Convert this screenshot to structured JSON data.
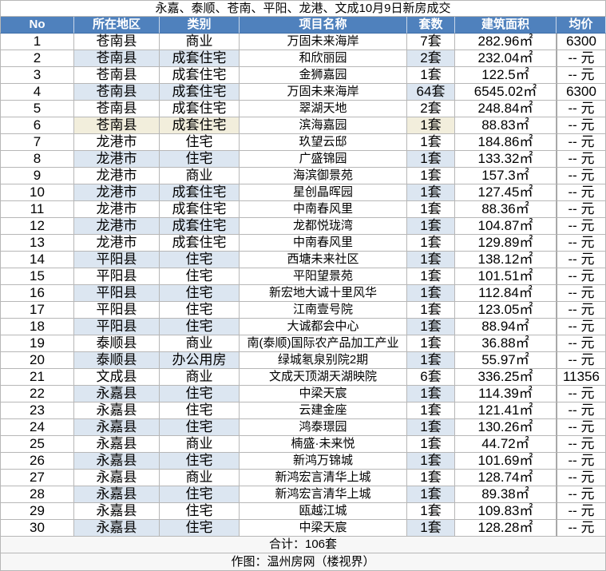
{
  "title": "永嘉、泰顺、苍南、平阳、龙港、文成10月9日新房成交",
  "colors": {
    "header_bg": "#4f81bd",
    "header_text": "#ffffff",
    "band": "#dce6f1",
    "highlight": "#f2eedc",
    "grid": "#b7b7b7"
  },
  "columns": [
    "No",
    "所在地区",
    "类别",
    "项目名称",
    "套数",
    "建筑面积",
    "均价"
  ],
  "rows": [
    {
      "no": "1",
      "district": "苍南县",
      "category": "商业",
      "project": "万固未来海岸",
      "units": "7套",
      "area": "282.96㎡",
      "price": "6300"
    },
    {
      "no": "2",
      "district": "苍南县",
      "category": "成套住宅",
      "project": "和欣丽园",
      "units": "2套",
      "area": "232.04㎡",
      "price": "-- 元"
    },
    {
      "no": "3",
      "district": "苍南县",
      "category": "成套住宅",
      "project": "金狮嘉园",
      "units": "1套",
      "area": "122.5㎡",
      "price": "-- 元"
    },
    {
      "no": "4",
      "district": "苍南县",
      "category": "成套住宅",
      "project": "万固未来海岸",
      "units": "64套",
      "area": "6545.02㎡",
      "price": "6300"
    },
    {
      "no": "5",
      "district": "苍南县",
      "category": "成套住宅",
      "project": "翠湖天地",
      "units": "2套",
      "area": "248.84㎡",
      "price": "-- 元"
    },
    {
      "no": "6",
      "district": "苍南县",
      "category": "成套住宅",
      "project": "滨海嘉园",
      "units": "1套",
      "area": "88.83㎡",
      "price": "-- 元"
    },
    {
      "no": "7",
      "district": "龙港市",
      "category": "住宅",
      "project": "玖望云邸",
      "units": "1套",
      "area": "184.86㎡",
      "price": "-- 元"
    },
    {
      "no": "8",
      "district": "龙港市",
      "category": "住宅",
      "project": "广盛锦园",
      "units": "1套",
      "area": "133.32㎡",
      "price": "-- 元"
    },
    {
      "no": "9",
      "district": "龙港市",
      "category": "商业",
      "project": "海滨御景苑",
      "units": "1套",
      "area": "157.3㎡",
      "price": "-- 元"
    },
    {
      "no": "10",
      "district": "龙港市",
      "category": "成套住宅",
      "project": "星创晶晖园",
      "units": "1套",
      "area": "127.45㎡",
      "price": "-- 元"
    },
    {
      "no": "11",
      "district": "龙港市",
      "category": "成套住宅",
      "project": "中南春风里",
      "units": "1套",
      "area": "88.36㎡",
      "price": "-- 元"
    },
    {
      "no": "12",
      "district": "龙港市",
      "category": "成套住宅",
      "project": "龙都悦珑湾",
      "units": "1套",
      "area": "104.87㎡",
      "price": "-- 元"
    },
    {
      "no": "13",
      "district": "龙港市",
      "category": "成套住宅",
      "project": "中南春风里",
      "units": "1套",
      "area": "129.89㎡",
      "price": "-- 元"
    },
    {
      "no": "14",
      "district": "平阳县",
      "category": "住宅",
      "project": "西塘未来社区",
      "units": "1套",
      "area": "138.12㎡",
      "price": "-- 元"
    },
    {
      "no": "15",
      "district": "平阳县",
      "category": "住宅",
      "project": "平阳望景苑",
      "units": "1套",
      "area": "101.51㎡",
      "price": "-- 元"
    },
    {
      "no": "16",
      "district": "平阳县",
      "category": "住宅",
      "project": "新宏地大诚十里风华",
      "units": "1套",
      "area": "112.84㎡",
      "price": "-- 元"
    },
    {
      "no": "17",
      "district": "平阳县",
      "category": "住宅",
      "project": "江南壹号院",
      "units": "1套",
      "area": "123.05㎡",
      "price": "-- 元"
    },
    {
      "no": "18",
      "district": "平阳县",
      "category": "住宅",
      "project": "大诚都会中心",
      "units": "1套",
      "area": "88.94㎡",
      "price": "-- 元"
    },
    {
      "no": "19",
      "district": "泰顺县",
      "category": "商业",
      "project": "南(泰顺)国际农产品加工产业",
      "units": "1套",
      "area": "36.88㎡",
      "price": "-- 元"
    },
    {
      "no": "20",
      "district": "泰顺县",
      "category": "办公用房",
      "project": "绿城氡泉别院2期",
      "units": "1套",
      "area": "55.97㎡",
      "price": "-- 元"
    },
    {
      "no": "21",
      "district": "文成县",
      "category": "商业",
      "project": "文成天顶湖天湖映院",
      "units": "6套",
      "area": "336.25㎡",
      "price": "11356"
    },
    {
      "no": "22",
      "district": "永嘉县",
      "category": "住宅",
      "project": "中梁天宸",
      "units": "1套",
      "area": "114.39㎡",
      "price": "-- 元"
    },
    {
      "no": "23",
      "district": "永嘉县",
      "category": "住宅",
      "project": "云建金座",
      "units": "1套",
      "area": "121.41㎡",
      "price": "-- 元"
    },
    {
      "no": "24",
      "district": "永嘉县",
      "category": "住宅",
      "project": "鸿泰璟园",
      "units": "1套",
      "area": "130.26㎡",
      "price": "-- 元"
    },
    {
      "no": "25",
      "district": "永嘉县",
      "category": "商业",
      "project": "楠盛·未来悦",
      "units": "1套",
      "area": "44.72㎡",
      "price": "-- 元"
    },
    {
      "no": "26",
      "district": "永嘉县",
      "category": "住宅",
      "project": "新鸿万锦城",
      "units": "1套",
      "area": "101.69㎡",
      "price": "-- 元"
    },
    {
      "no": "27",
      "district": "永嘉县",
      "category": "商业",
      "project": "新鸿宏言清华上城",
      "units": "1套",
      "area": "128.74㎡",
      "price": "-- 元"
    },
    {
      "no": "28",
      "district": "永嘉县",
      "category": "住宅",
      "project": "新鸿宏言清华上城",
      "units": "1套",
      "area": "89.38㎡",
      "price": "-- 元"
    },
    {
      "no": "29",
      "district": "永嘉县",
      "category": "住宅",
      "project": "瓯越江城",
      "units": "1套",
      "area": "109.83㎡",
      "price": "-- 元"
    },
    {
      "no": "30",
      "district": "永嘉县",
      "category": "住宅",
      "project": "中梁天宸",
      "units": "1套",
      "area": "128.28㎡",
      "price": "-- 元"
    }
  ],
  "total": "合计：106套",
  "credit": "作图：温州房网（楼视界）"
}
